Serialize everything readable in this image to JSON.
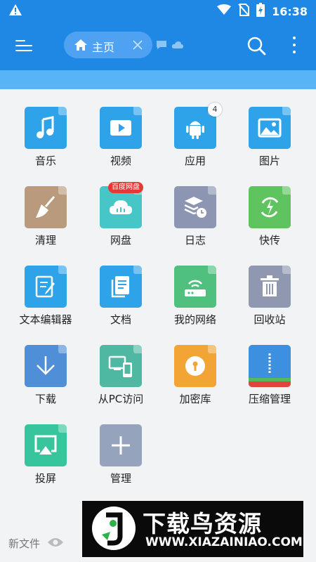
{
  "status_bar": {
    "time": "16:38"
  },
  "toolbar": {
    "tab_label": "主页"
  },
  "grid": [
    {
      "label": "音乐",
      "color": "#2fa3ea",
      "icon": "music-note-icon"
    },
    {
      "label": "视频",
      "color": "#2fa3ea",
      "icon": "video-play-icon"
    },
    {
      "label": "应用",
      "color": "#2fa3ea",
      "icon": "android-icon",
      "badge": "4"
    },
    {
      "label": "图片",
      "color": "#2fa3ea",
      "icon": "image-icon"
    },
    {
      "label": "清理",
      "color": "#b99a7d",
      "icon": "broom-icon"
    },
    {
      "label": "网盘",
      "color": "#46c6c6",
      "icon": "cloud-icon",
      "tag": "百度网盘"
    },
    {
      "label": "日志",
      "color": "#8c96b2",
      "icon": "log-icon"
    },
    {
      "label": "快传",
      "color": "#5fc45f",
      "icon": "transfer-icon"
    },
    {
      "label": "文本编辑器",
      "color": "#2fa3ea",
      "icon": "edit-icon"
    },
    {
      "label": "文档",
      "color": "#2fa3ea",
      "icon": "document-icon"
    },
    {
      "label": "我的网络",
      "color": "#4fc07e",
      "icon": "router-icon"
    },
    {
      "label": "回收站",
      "color": "#8f98b0",
      "icon": "trash-icon"
    },
    {
      "label": "下载",
      "color": "#4f8fd8",
      "icon": "download-icon"
    },
    {
      "label": "从PC访问",
      "color": "#4fb8a3",
      "icon": "pc-access-icon"
    },
    {
      "label": "加密库",
      "color": "#f2a534",
      "icon": "lock-icon"
    },
    {
      "label": "压缩管理",
      "color": "#3d8fe0",
      "icon": "zip-icon"
    },
    {
      "label": "投屏",
      "color": "#36c59c",
      "icon": "cast-icon"
    },
    {
      "label": "管理",
      "color": "#96a3bd",
      "icon": "plus-icon"
    }
  ],
  "bottom": {
    "new_file": "新文件"
  },
  "watermark": {
    "title": "下载鸟资源",
    "url": "WWW.XIAZAINIAO.COM"
  }
}
